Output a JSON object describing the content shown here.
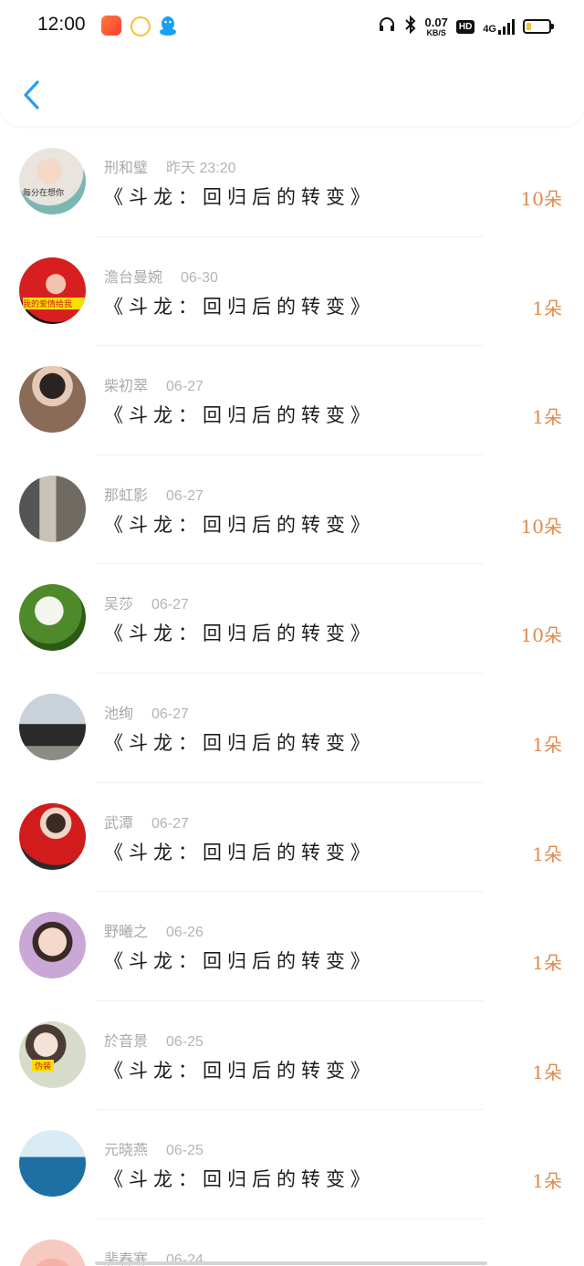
{
  "status_bar": {
    "time": "12:00",
    "net_speed_value": "0.07",
    "net_speed_unit": "KB/S",
    "hd_label": "HD",
    "network_label": "4G",
    "battery_level": 0.2
  },
  "colors": {
    "accent_blue": "#2a9df4",
    "amount_orange": "#e08a4e",
    "battery_yellow": "#f3c330"
  },
  "list": [
    {
      "name": "刑和璧",
      "time": "昨天 23:20",
      "title": "《斗龙：回归后的转变》",
      "amount": "10朵",
      "avatar_tag": "每分在想你"
    },
    {
      "name": "澹台曼婉",
      "time": "06-30",
      "title": "《斗龙：回归后的转变》",
      "amount": "1朵",
      "avatar_tag": "我的爱情给我"
    },
    {
      "name": "柴初翠",
      "time": "06-27",
      "title": "《斗龙：回归后的转变》",
      "amount": "1朵",
      "avatar_tag": ""
    },
    {
      "name": "那虹影",
      "time": "06-27",
      "title": "《斗龙：回归后的转变》",
      "amount": "10朵",
      "avatar_tag": ""
    },
    {
      "name": "吴莎",
      "time": "06-27",
      "title": "《斗龙：回归后的转变》",
      "amount": "10朵",
      "avatar_tag": ""
    },
    {
      "name": "池绚",
      "time": "06-27",
      "title": "《斗龙：回归后的转变》",
      "amount": "1朵",
      "avatar_tag": ""
    },
    {
      "name": "武潭",
      "time": "06-27",
      "title": "《斗龙：回归后的转变》",
      "amount": "1朵",
      "avatar_tag": ""
    },
    {
      "name": "野曦之",
      "time": "06-26",
      "title": "《斗龙：回归后的转变》",
      "amount": "1朵",
      "avatar_tag": ""
    },
    {
      "name": "於音景",
      "time": "06-25",
      "title": "《斗龙：回归后的转变》",
      "amount": "1朵",
      "avatar_tag": "伪装"
    },
    {
      "name": "元晓燕",
      "time": "06-25",
      "title": "《斗龙：回归后的转变》",
      "amount": "1朵",
      "avatar_tag": ""
    },
    {
      "name": "裴春寒",
      "time": "06-24",
      "title": "",
      "amount": "",
      "avatar_tag": ""
    }
  ]
}
